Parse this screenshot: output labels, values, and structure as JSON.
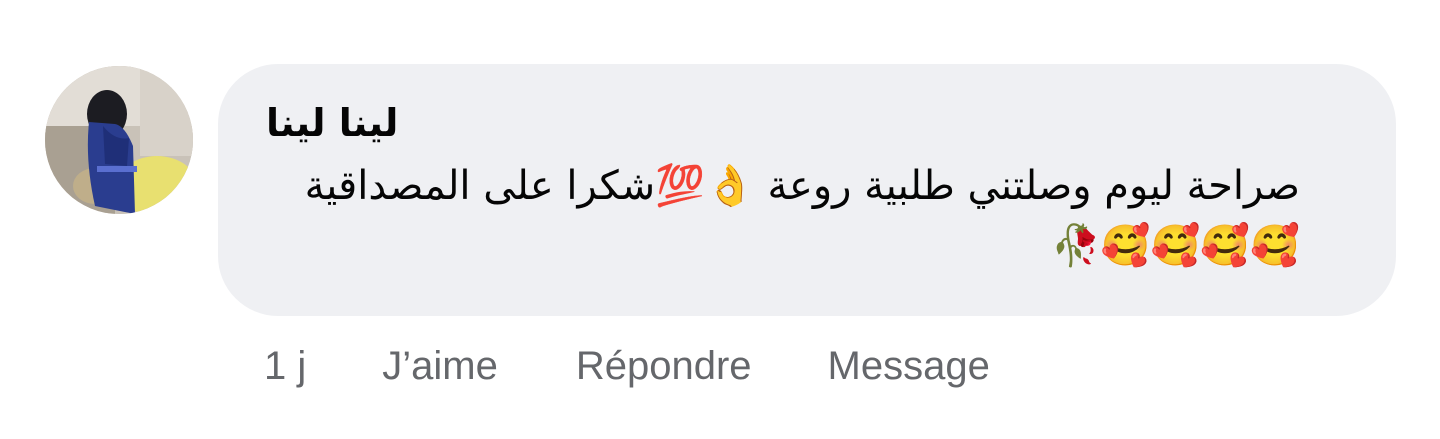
{
  "comment": {
    "author": "لينا لينا",
    "text": "صراحة ليوم وصلتني طلبية روعة 👌💯شكرا على المصداقية 🥰🥰🥰🥰🥀"
  },
  "actions": {
    "time": "1 j",
    "like": "J’aime",
    "reply": "Répondre",
    "message": "Message"
  },
  "colors": {
    "bubble": "#eff0f3",
    "action_text": "#65676b",
    "text": "#050505"
  },
  "icons": {
    "avatar": "user-photo"
  }
}
